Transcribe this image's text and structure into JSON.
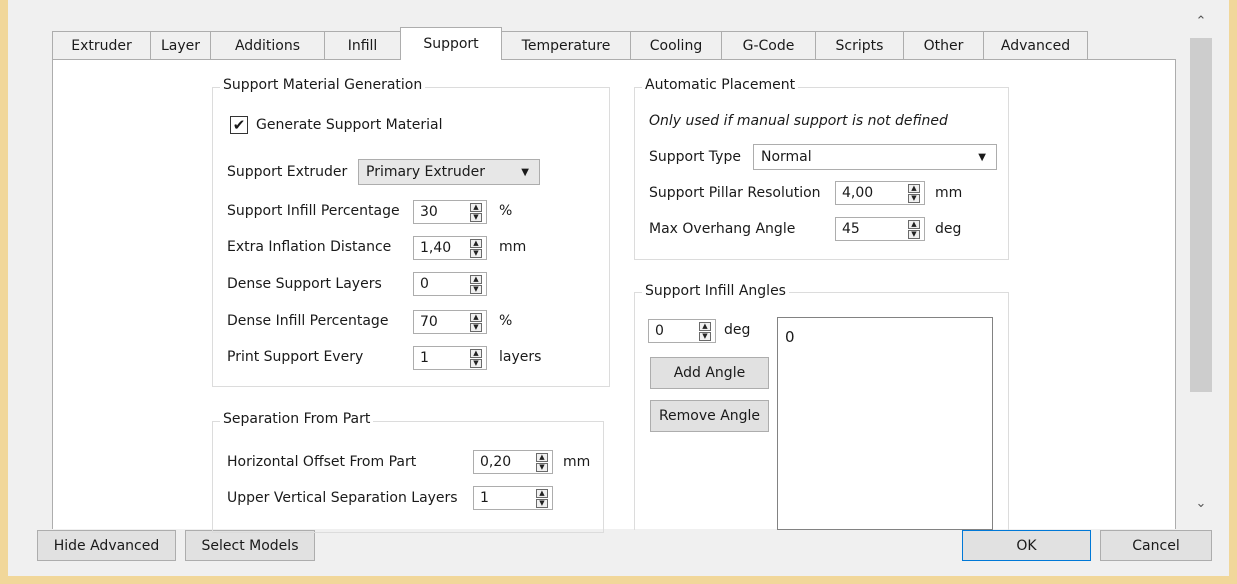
{
  "tabs": [
    {
      "label": "Extruder"
    },
    {
      "label": "Layer"
    },
    {
      "label": "Additions"
    },
    {
      "label": "Infill"
    },
    {
      "label": "Support",
      "active": true
    },
    {
      "label": "Temperature"
    },
    {
      "label": "Cooling"
    },
    {
      "label": "G-Code"
    },
    {
      "label": "Scripts"
    },
    {
      "label": "Other"
    },
    {
      "label": "Advanced"
    }
  ],
  "support_material_generation": {
    "title": "Support Material Generation",
    "generate_support": {
      "label": "Generate Support Material",
      "checked": true
    },
    "support_extruder": {
      "label": "Support Extruder",
      "value": "Primary Extruder"
    },
    "support_infill_percentage": {
      "label": "Support Infill Percentage",
      "value": "30",
      "unit": "%"
    },
    "extra_inflation_distance": {
      "label": "Extra Inflation Distance",
      "value": "1,40",
      "unit": "mm"
    },
    "dense_support_layers": {
      "label": "Dense Support Layers",
      "value": "0"
    },
    "dense_infill_percentage": {
      "label": "Dense Infill Percentage",
      "value": "70",
      "unit": "%"
    },
    "print_support_every": {
      "label": "Print Support Every",
      "value": "1",
      "unit": "layers"
    }
  },
  "separation_from_part": {
    "title": "Separation From Part",
    "horizontal_offset": {
      "label": "Horizontal Offset From Part",
      "value": "0,20",
      "unit": "mm"
    },
    "upper_vertical_separation": {
      "label": "Upper Vertical Separation Layers",
      "value": "1"
    }
  },
  "automatic_placement": {
    "title": "Automatic Placement",
    "note": "Only used if manual support is not defined",
    "support_type": {
      "label": "Support Type",
      "value": "Normal"
    },
    "pillar_resolution": {
      "label": "Support Pillar Resolution",
      "value": "4,00",
      "unit": "mm"
    },
    "max_overhang_angle": {
      "label": "Max Overhang Angle",
      "value": "45",
      "unit": "deg"
    }
  },
  "support_infill_angles": {
    "title": "Support Infill Angles",
    "angle_input": {
      "value": "0",
      "unit": "deg"
    },
    "add_angle_label": "Add Angle",
    "remove_angle_label": "Remove Angle",
    "angles": [
      "0"
    ]
  },
  "footer": {
    "hide_advanced_label": "Hide Advanced",
    "select_models_label": "Select Models",
    "ok_label": "OK",
    "cancel_label": "Cancel"
  },
  "icons": {
    "checkmark": "check-icon",
    "dropdown": "chevron-down-icon",
    "spin": "spin-arrows-icon",
    "scroll_up": "scroll-up-icon",
    "scroll_down": "scroll-down-icon"
  },
  "colors": {
    "window_border": "#f1d79a",
    "dialog_bg": "#f0f0f0",
    "primary_button_border": "#0078d7"
  }
}
